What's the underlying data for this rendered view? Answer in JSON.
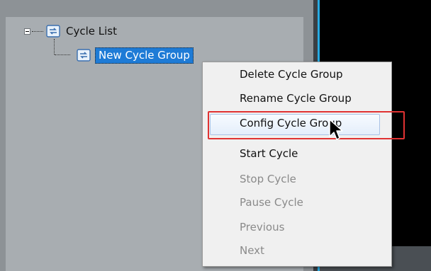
{
  "tree": {
    "root_label": "Cycle List",
    "child_label": "New Cycle Group"
  },
  "context_menu": {
    "items": [
      {
        "label": "Delete Cycle Group",
        "enabled": true
      },
      {
        "label": "Rename Cycle Group",
        "enabled": true
      },
      {
        "label": "Config Cycle Group",
        "enabled": true,
        "highlighted": true
      },
      {
        "label": "Start Cycle",
        "enabled": true
      },
      {
        "label": "Stop Cycle",
        "enabled": false
      },
      {
        "label": "Pause Cycle",
        "enabled": false
      },
      {
        "label": "Previous",
        "enabled": false
      },
      {
        "label": "Next",
        "enabled": false
      }
    ]
  },
  "icons": {
    "tree_expander": "minus-expander-icon",
    "cycle_icon": "cycle-list-icon",
    "pointer": "mouse-pointer-icon"
  },
  "colors": {
    "selection": "#1e7bd6",
    "highlight_outline": "#e03232",
    "accent_line": "#27a9e1"
  }
}
